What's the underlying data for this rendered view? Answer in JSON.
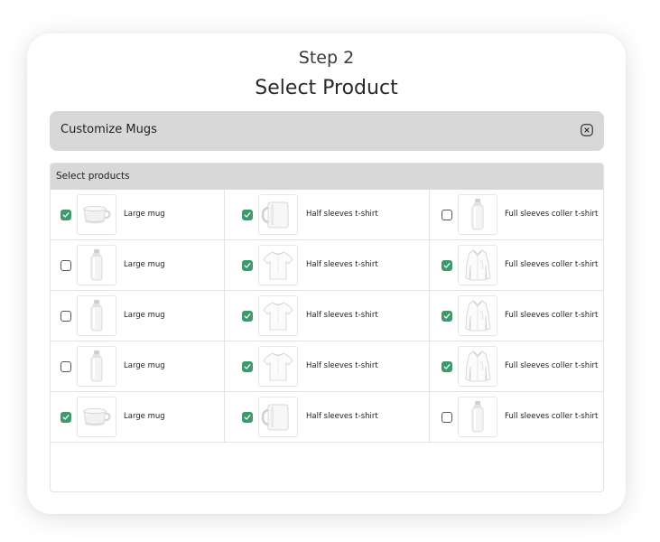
{
  "header": {
    "step": "Step 2",
    "title": "Select Product"
  },
  "customize": {
    "title": "Customize Mugs",
    "close_icon": "close-icon"
  },
  "products": {
    "header": "Select products",
    "rows": [
      [
        {
          "label": "Large mug",
          "checked": true,
          "image": "mug"
        },
        {
          "label": "Half sleeves t-shirt",
          "checked": true,
          "image": "glass-mug"
        },
        {
          "label": "Full sleeves coller t-shirt",
          "checked": false,
          "image": "bottle"
        }
      ],
      [
        {
          "label": "Large mug",
          "checked": false,
          "image": "bottle"
        },
        {
          "label": "Half sleeves t-shirt",
          "checked": true,
          "image": "tshirt"
        },
        {
          "label": "Full sleeves coller t-shirt",
          "checked": true,
          "image": "shirt"
        }
      ],
      [
        {
          "label": "Large mug",
          "checked": false,
          "image": "bottle"
        },
        {
          "label": "Half sleeves t-shirt",
          "checked": true,
          "image": "tshirt"
        },
        {
          "label": "Full sleeves coller t-shirt",
          "checked": true,
          "image": "shirt"
        }
      ],
      [
        {
          "label": "Large mug",
          "checked": false,
          "image": "bottle"
        },
        {
          "label": "Half sleeves t-shirt",
          "checked": true,
          "image": "tshirt"
        },
        {
          "label": "Full sleeves coller t-shirt",
          "checked": true,
          "image": "shirt"
        }
      ],
      [
        {
          "label": "Large mug",
          "checked": true,
          "image": "mug"
        },
        {
          "label": "Half sleeves t-shirt",
          "checked": true,
          "image": "glass-mug"
        },
        {
          "label": "Full sleeves coller t-shirt",
          "checked": false,
          "image": "bottle"
        }
      ]
    ]
  },
  "colors": {
    "accent": "#3e9a6c",
    "bar": "#d8d8d8"
  }
}
